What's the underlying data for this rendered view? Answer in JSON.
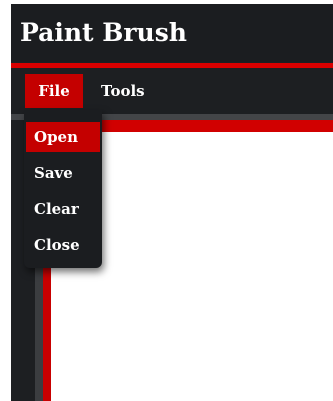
{
  "app": {
    "title": "Paint Brush"
  },
  "menu_bar": {
    "items": [
      {
        "label": "File",
        "active": true
      },
      {
        "label": "Tools",
        "active": false
      }
    ]
  },
  "file_menu": {
    "items": [
      {
        "label": "Open",
        "highlighted": true
      },
      {
        "label": "Save",
        "highlighted": false
      },
      {
        "label": "Clear",
        "highlighted": false
      },
      {
        "label": "Close",
        "highlighted": false
      }
    ]
  },
  "colors": {
    "accent": "#c40000",
    "background": "#1d1f22",
    "canvas": "#ffffff",
    "text": "#ffffff"
  }
}
